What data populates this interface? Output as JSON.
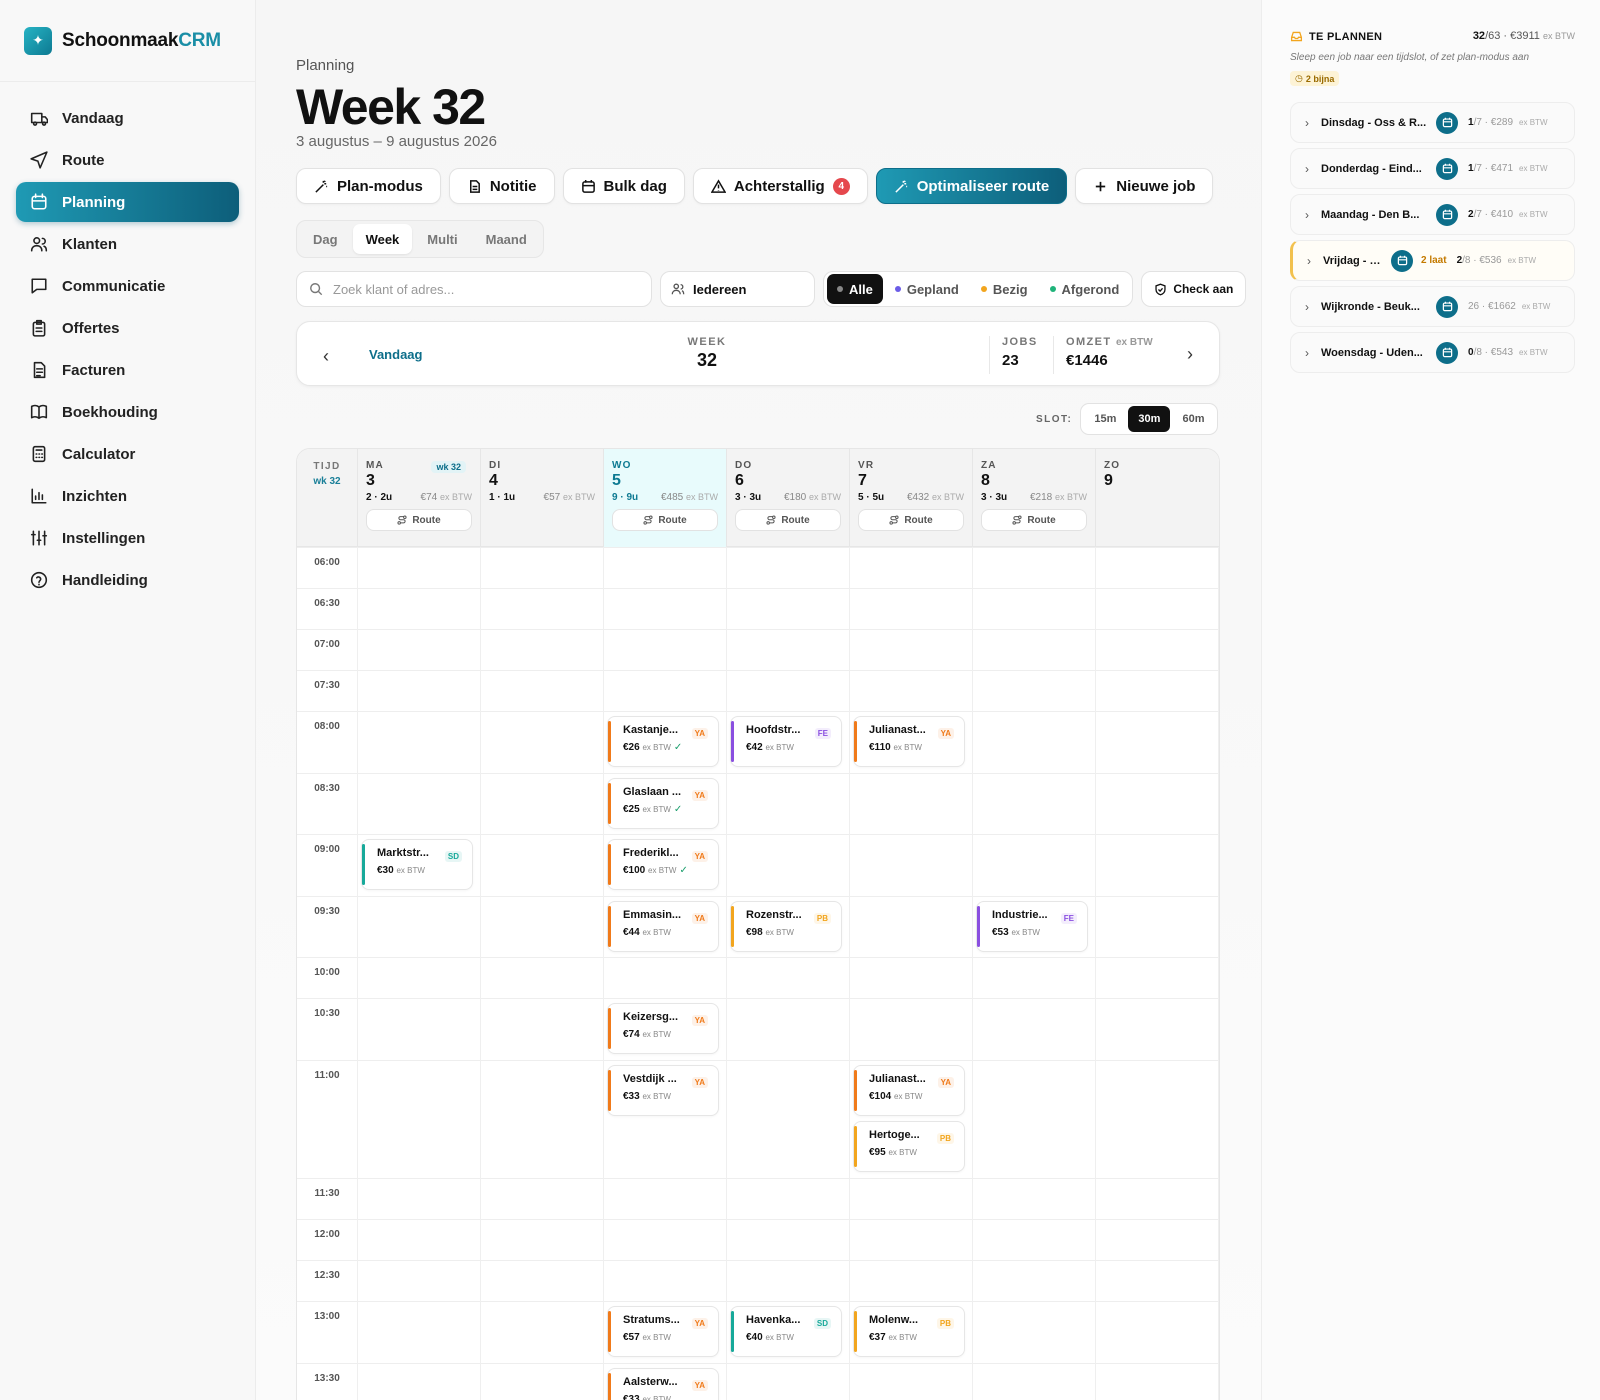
{
  "brand": {
    "name_main": "Schoonmaak",
    "name_accent": "CRM",
    "logo_glyph": "✦"
  },
  "nav": [
    {
      "label": "Vandaag",
      "icon": "truck-icon",
      "active": false
    },
    {
      "label": "Route",
      "icon": "navigation-icon",
      "active": false
    },
    {
      "label": "Planning",
      "icon": "calendar-icon",
      "active": true
    },
    {
      "label": "Klanten",
      "icon": "users-icon",
      "active": false
    },
    {
      "label": "Communicatie",
      "icon": "message-icon",
      "active": false
    },
    {
      "label": "Offertes",
      "icon": "clipboard-icon",
      "active": false
    },
    {
      "label": "Facturen",
      "icon": "file-icon",
      "active": false
    },
    {
      "label": "Boekhouding",
      "icon": "book-icon",
      "active": false
    },
    {
      "label": "Calculator",
      "icon": "calculator-icon",
      "active": false
    },
    {
      "label": "Inzichten",
      "icon": "bar-chart-icon",
      "active": false
    },
    {
      "label": "Instellingen",
      "icon": "sliders-icon",
      "active": false
    },
    {
      "label": "Handleiding",
      "icon": "help-icon",
      "active": false
    }
  ],
  "header": {
    "crumb": "Planning",
    "title": "Week 32",
    "daterange": "3 augustus – 9 augustus 2026"
  },
  "toolbar": {
    "plan_mode": "Plan-modus",
    "note": "Notitie",
    "bulk_day": "Bulk dag",
    "overdue": "Achterstallig",
    "overdue_count": "4",
    "optimize": "Optimaliseer route",
    "new_job": "Nieuwe job"
  },
  "view_tabs": [
    "Dag",
    "Week",
    "Multi",
    "Maand"
  ],
  "view_active": "Week",
  "filters": {
    "search_placeholder": "Zoek klant of adres...",
    "who": "Iedereen",
    "statuses": [
      {
        "label": "Alle",
        "color": "#888888",
        "active": true
      },
      {
        "label": "Gepland",
        "color": "#6b5ce7",
        "active": false
      },
      {
        "label": "Bezig",
        "color": "#f2a51e",
        "active": false
      },
      {
        "label": "Afgerond",
        "color": "#1fb37a",
        "active": false
      }
    ],
    "check": "Check aan"
  },
  "weeknav": {
    "today": "Vandaag",
    "week_label": "WEEK",
    "week_num": "32",
    "jobs_label": "JOBS",
    "jobs": "23",
    "revenue_label": "OMZET",
    "revenue_suffix": "ex BTW",
    "revenue": "€1446"
  },
  "slot": {
    "label": "SLOT:",
    "options": [
      "15m",
      "30m",
      "60m"
    ],
    "active": "30m"
  },
  "calendar": {
    "time_header": "TIJD",
    "week_badge": "wk 32",
    "ex_btw": "ex BTW",
    "route_label": "Route",
    "days": [
      {
        "name": "MA",
        "num": "3",
        "jobs": "2 · 2u",
        "revenue": "€74",
        "wk": "wk 32",
        "route": true,
        "today": false
      },
      {
        "name": "DI",
        "num": "4",
        "jobs": "1 · 1u",
        "revenue": "€57",
        "wk": "",
        "route": false,
        "today": false
      },
      {
        "name": "WO",
        "num": "5",
        "jobs": "9 · 9u",
        "revenue": "€485",
        "wk": "",
        "route": true,
        "today": true
      },
      {
        "name": "DO",
        "num": "6",
        "jobs": "3 · 3u",
        "revenue": "€180",
        "wk": "",
        "route": true,
        "today": false
      },
      {
        "name": "VR",
        "num": "7",
        "jobs": "5 · 5u",
        "revenue": "€432",
        "wk": "",
        "route": true,
        "today": false
      },
      {
        "name": "ZA",
        "num": "8",
        "jobs": "3 · 3u",
        "revenue": "€218",
        "wk": "",
        "route": true,
        "today": false
      },
      {
        "name": "ZO",
        "num": "9",
        "jobs": "",
        "revenue": "",
        "wk": "",
        "route": false,
        "today": false
      }
    ],
    "times": [
      "06:00",
      "06:30",
      "07:00",
      "07:30",
      "08:00",
      "08:30",
      "09:00",
      "09:30",
      "10:00",
      "10:30",
      "11:00",
      "11:30",
      "12:00",
      "12:30",
      "13:00",
      "13:30"
    ],
    "row_spans": [
      1,
      1,
      1,
      1,
      1.5,
      1.5,
      1.5,
      1.5,
      1,
      1.5,
      2.9,
      1,
      1,
      1,
      1.5,
      1.5
    ],
    "jobs": [
      {
        "day": 0,
        "row": 6,
        "offset": 0,
        "title": "Marktstr...",
        "tag": "SD",
        "price": "€30",
        "color": "#17a99a",
        "check": false
      },
      {
        "day": 2,
        "row": 4,
        "offset": 0,
        "title": "Kastanje...",
        "tag": "YA",
        "price": "€26",
        "color": "#f07a1a",
        "check": true
      },
      {
        "day": 2,
        "row": 5,
        "offset": 0,
        "title": "Glaslaan ...",
        "tag": "YA",
        "price": "€25",
        "color": "#f07a1a",
        "check": true
      },
      {
        "day": 2,
        "row": 6,
        "offset": 0,
        "title": "Frederikl...",
        "tag": "YA",
        "price": "€100",
        "color": "#f07a1a",
        "check": true
      },
      {
        "day": 2,
        "row": 7,
        "offset": 0,
        "title": "Emmasin...",
        "tag": "YA",
        "price": "€44",
        "color": "#f07a1a",
        "check": false
      },
      {
        "day": 2,
        "row": 9,
        "offset": 0,
        "title": "Keizersg...",
        "tag": "YA",
        "price": "€74",
        "color": "#f07a1a",
        "check": false
      },
      {
        "day": 2,
        "row": 10,
        "offset": 0,
        "title": "Vestdijk ...",
        "tag": "YA",
        "price": "€33",
        "color": "#f07a1a",
        "check": false
      },
      {
        "day": 2,
        "row": 14,
        "offset": 0,
        "title": "Stratums...",
        "tag": "YA",
        "price": "€57",
        "color": "#f07a1a",
        "check": false
      },
      {
        "day": 2,
        "row": 15,
        "offset": 0,
        "title": "Aalsterw...",
        "tag": "YA",
        "price": "€33",
        "color": "#f07a1a",
        "check": false
      },
      {
        "day": 3,
        "row": 4,
        "offset": 0,
        "title": "Hoofdstr...",
        "tag": "FE",
        "price": "€42",
        "color": "#8a4fe0",
        "check": false
      },
      {
        "day": 3,
        "row": 7,
        "offset": 0,
        "title": "Rozenstr...",
        "tag": "PB",
        "price": "€98",
        "color": "#f2a51e",
        "check": false
      },
      {
        "day": 3,
        "row": 14,
        "offset": 0,
        "title": "Havenka...",
        "tag": "SD",
        "price": "€40",
        "color": "#17a99a",
        "check": false
      },
      {
        "day": 4,
        "row": 4,
        "offset": 0,
        "title": "Julianast...",
        "tag": "YA",
        "price": "€110",
        "color": "#f07a1a",
        "check": false
      },
      {
        "day": 4,
        "row": 10,
        "offset": 0,
        "title": "Julianast...",
        "tag": "YA",
        "price": "€104",
        "color": "#f07a1a",
        "check": false
      },
      {
        "day": 4,
        "row": 10,
        "offset": 1,
        "title": "Hertoge...",
        "tag": "PB",
        "price": "€95",
        "color": "#f2a51e",
        "check": false
      },
      {
        "day": 4,
        "row": 14,
        "offset": 0,
        "title": "Molenw...",
        "tag": "PB",
        "price": "€37",
        "color": "#f2a51e",
        "check": false
      },
      {
        "day": 5,
        "row": 7,
        "offset": 0,
        "title": "Industrie...",
        "tag": "FE",
        "price": "€53",
        "color": "#8a4fe0",
        "check": false
      }
    ]
  },
  "rightpanel": {
    "title": "TE PLANNEN",
    "count": "32",
    "total": "/63",
    "revenue": "€3911",
    "ex_btw": "ex BTW",
    "subtitle": "Sleep een job naar een tijdslot, of zet plan-modus aan",
    "badge": "2 bijna",
    "items": [
      {
        "name": "Dinsdag - Oss & R...",
        "late": "",
        "planned": "1",
        "total": "/7",
        "revenue": "€289",
        "warn": false
      },
      {
        "name": "Donderdag - Eind...",
        "late": "",
        "planned": "1",
        "total": "/7",
        "revenue": "€471",
        "warn": false
      },
      {
        "name": "Maandag - Den B...",
        "late": "",
        "planned": "2",
        "total": "/7",
        "revenue": "€410",
        "warn": false
      },
      {
        "name": "Vrijdag - Z...",
        "late": "2 laat",
        "planned": "2",
        "total": "/8",
        "revenue": "€536",
        "warn": true
      },
      {
        "name": "Wijkronde - Beuk...",
        "late": "",
        "planned": "",
        "total": "26",
        "revenue": "€1662",
        "warn": false
      },
      {
        "name": "Woensdag - Uden...",
        "late": "",
        "planned": "0",
        "total": "/8",
        "revenue": "€543",
        "warn": false
      }
    ]
  }
}
